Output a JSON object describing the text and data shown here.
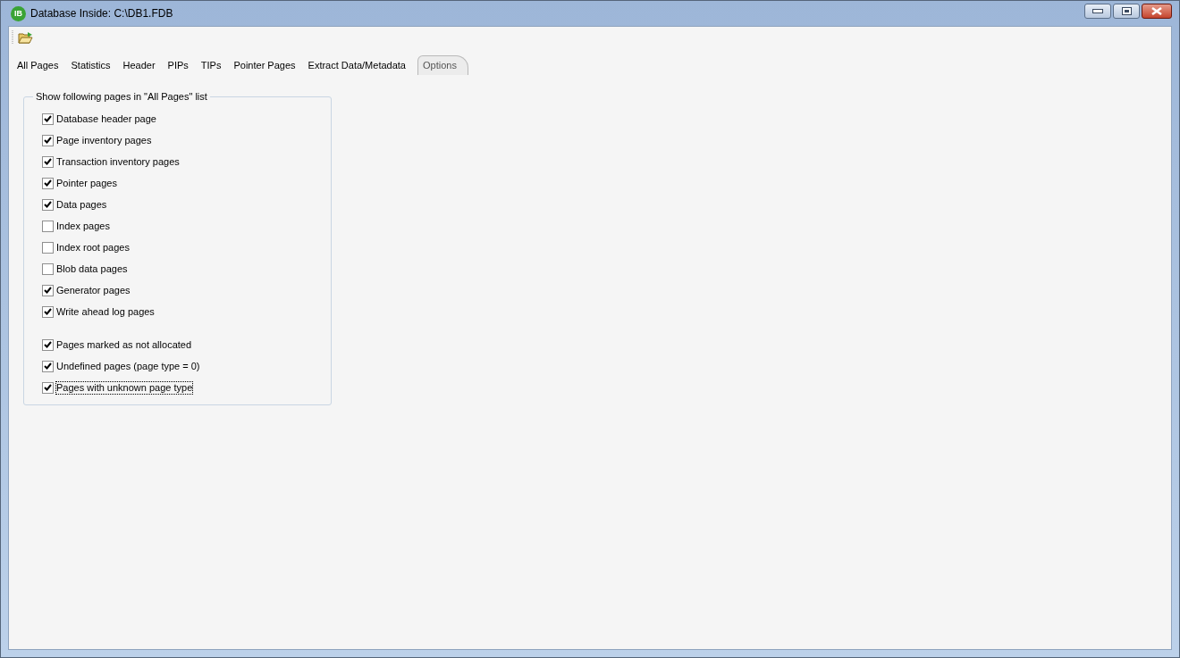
{
  "window": {
    "title": "Database Inside: C:\\DB1.FDB",
    "logo": "IB"
  },
  "tabs": [
    {
      "label": "All Pages",
      "selected": false
    },
    {
      "label": "Statistics",
      "selected": false
    },
    {
      "label": "Header",
      "selected": false
    },
    {
      "label": "PIPs",
      "selected": false
    },
    {
      "label": "TIPs",
      "selected": false
    },
    {
      "label": "Pointer Pages",
      "selected": false
    },
    {
      "label": "Extract Data/Metadata",
      "selected": false
    },
    {
      "label": "Options",
      "selected": true
    }
  ],
  "options_group": {
    "title": "Show following pages in \"All Pages\"  list",
    "sections": [
      [
        {
          "label": "Database header page",
          "checked": true,
          "focused": false
        },
        {
          "label": "Page inventory pages",
          "checked": true,
          "focused": false
        },
        {
          "label": "Transaction inventory pages",
          "checked": true,
          "focused": false
        },
        {
          "label": "Pointer pages",
          "checked": true,
          "focused": false
        },
        {
          "label": "Data pages",
          "checked": true,
          "focused": false
        },
        {
          "label": "Index pages",
          "checked": false,
          "focused": false
        },
        {
          "label": "Index root pages",
          "checked": false,
          "focused": false
        },
        {
          "label": "Blob data pages",
          "checked": false,
          "focused": false
        },
        {
          "label": "Generator pages",
          "checked": true,
          "focused": false
        },
        {
          "label": "Write ahead log pages",
          "checked": true,
          "focused": false
        }
      ],
      [
        {
          "label": "Pages marked as not allocated",
          "checked": true,
          "focused": false
        },
        {
          "label": "Undefined pages (page type = 0)",
          "checked": true,
          "focused": false
        },
        {
          "label": "Pages with unknown page type",
          "checked": true,
          "focused": true
        }
      ]
    ]
  }
}
